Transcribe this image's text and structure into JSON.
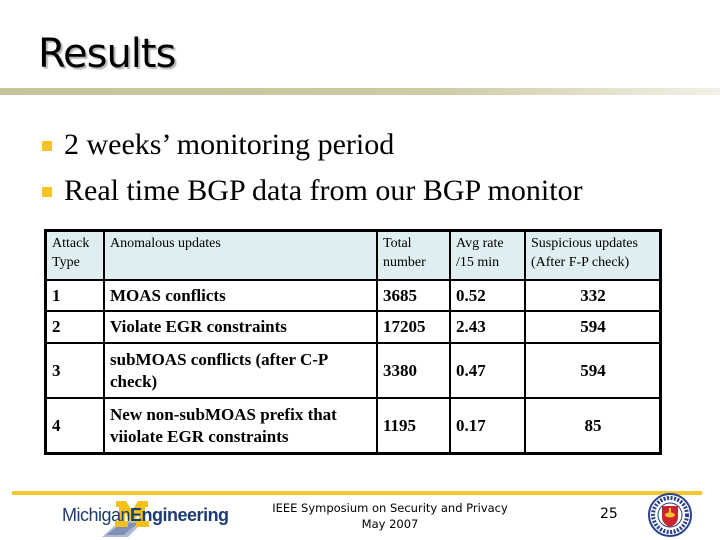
{
  "slide": {
    "title": "Results",
    "bullets": [
      "2 weeks’ monitoring period",
      "Real time BGP data from our BGP monitor"
    ]
  },
  "table": {
    "headers": [
      "Attack Type",
      "Anomalous updates",
      "Total number",
      "Avg rate /15 min",
      "Suspicious updates (After F-P check)"
    ],
    "rows": [
      {
        "type": "1",
        "anomaly": "MOAS conflicts",
        "total": "3685",
        "avg_rate": "0.52",
        "suspicious": "332"
      },
      {
        "type": "2",
        "anomaly": "Violate EGR constraints",
        "total": "17205",
        "avg_rate": "2.43",
        "suspicious": "594"
      },
      {
        "type": "3",
        "anomaly": "subMOAS conflicts (after C-P check)",
        "total": "3380",
        "avg_rate": "0.47",
        "suspicious": "594"
      },
      {
        "type": "4",
        "anomaly": "New non-subMOAS prefix that viiolate EGR constraints",
        "total": "1195",
        "avg_rate": "0.17",
        "suspicious": "85"
      }
    ]
  },
  "footer": {
    "logo_text_light": "Michigan",
    "logo_text_bold": "Engineering",
    "conference_line1": "IEEE Symposium on Security and Privacy",
    "conference_line2": "May 2007",
    "page_number": "25"
  },
  "colors": {
    "bullet": "#f7c21c",
    "header_bg": "#dfeef0",
    "footer_line": "#f2c830",
    "logo_blue": "#1d3b74",
    "title_bar": "#c9c39a"
  }
}
